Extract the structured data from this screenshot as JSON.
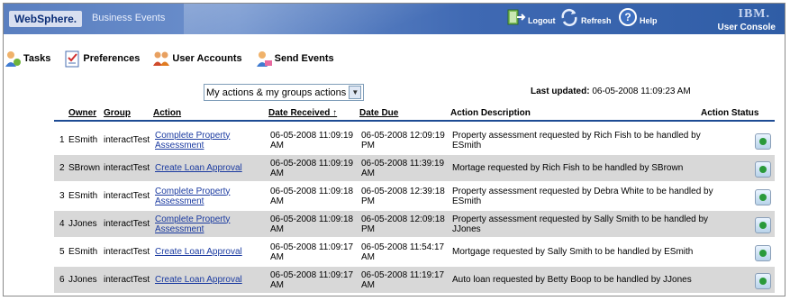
{
  "header": {
    "brand": "WebSphere.",
    "product": "Business Events",
    "logout_label": "Logout",
    "refresh_label": "Refresh",
    "help_label": "Help",
    "ibm_logo": "IBM.",
    "user_console_label": "User Console"
  },
  "toolbar": {
    "tasks_label": "Tasks",
    "preferences_label": "Preferences",
    "user_accounts_label": "User Accounts",
    "send_events_label": "Send Events"
  },
  "filter": {
    "selected": "My actions & my groups actions"
  },
  "last_updated": {
    "label": "Last updated:",
    "value": "06-05-2008 11:09:23 AM"
  },
  "table": {
    "columns": {
      "owner": "Owner",
      "group": "Group",
      "action": "Action",
      "date_received": "Date Received ↑",
      "date_due": "Date Due",
      "action_description": "Action Description",
      "action_status": "Action Status"
    },
    "rows": [
      {
        "num": "1",
        "owner": "ESmith",
        "group": "interactTest",
        "action_1": "Complete Property",
        "action_2": "Assessment",
        "received_1": "06-05-2008 11:09:19",
        "received_2": "AM",
        "due_1": "06-05-2008 12:09:19",
        "due_2": "PM",
        "desc_1": "Property assessment requested by Rich Fish to be handled by",
        "desc_2": "ESmith"
      },
      {
        "num": "2",
        "owner": "SBrown",
        "group": "interactTest",
        "action_1": "Create Loan Approval",
        "action_2": "",
        "received_1": "06-05-2008 11:09:19",
        "received_2": "AM",
        "due_1": "06-05-2008 11:39:19",
        "due_2": "AM",
        "desc_1": "Mortage requested by Rich Fish to be handled by SBrown",
        "desc_2": ""
      },
      {
        "num": "3",
        "owner": "ESmith",
        "group": "interactTest",
        "action_1": "Complete Property",
        "action_2": "Assessment",
        "received_1": "06-05-2008 11:09:18",
        "received_2": "AM",
        "due_1": "06-05-2008 12:39:18",
        "due_2": "PM",
        "desc_1": "Property assessment requested by Debra White to be handled by",
        "desc_2": "ESmith"
      },
      {
        "num": "4",
        "owner": "JJones",
        "group": "interactTest",
        "action_1": "Complete Property",
        "action_2": "Assessment",
        "received_1": "06-05-2008 11:09:18",
        "received_2": "AM",
        "due_1": "06-05-2008 12:09:18",
        "due_2": "PM",
        "desc_1": "Property assessment requested by Sally Smith to be handled by",
        "desc_2": "JJones"
      },
      {
        "num": "5",
        "owner": "ESmith",
        "group": "interactTest",
        "action_1": "Create Loan Approval",
        "action_2": "",
        "received_1": "06-05-2008 11:09:17",
        "received_2": "AM",
        "due_1": "06-05-2008 11:54:17",
        "due_2": "AM",
        "desc_1": "Mortgage requested by Sally Smith to be handled by ESmith",
        "desc_2": ""
      },
      {
        "num": "6",
        "owner": "JJones",
        "group": "interactTest",
        "action_1": "Create Loan Approval",
        "action_2": "",
        "received_1": "06-05-2008 11:09:17",
        "received_2": "AM",
        "due_1": "06-05-2008 11:19:17",
        "due_2": "AM",
        "desc_1": "Auto loan requested by Betty Boop to be handled by JJones",
        "desc_2": ""
      }
    ]
  },
  "colors": {
    "header_blue": "#3f69b3",
    "alt_row": "#d8d8d8",
    "link": "#1a3aa0",
    "rule": "#1e4b94"
  }
}
